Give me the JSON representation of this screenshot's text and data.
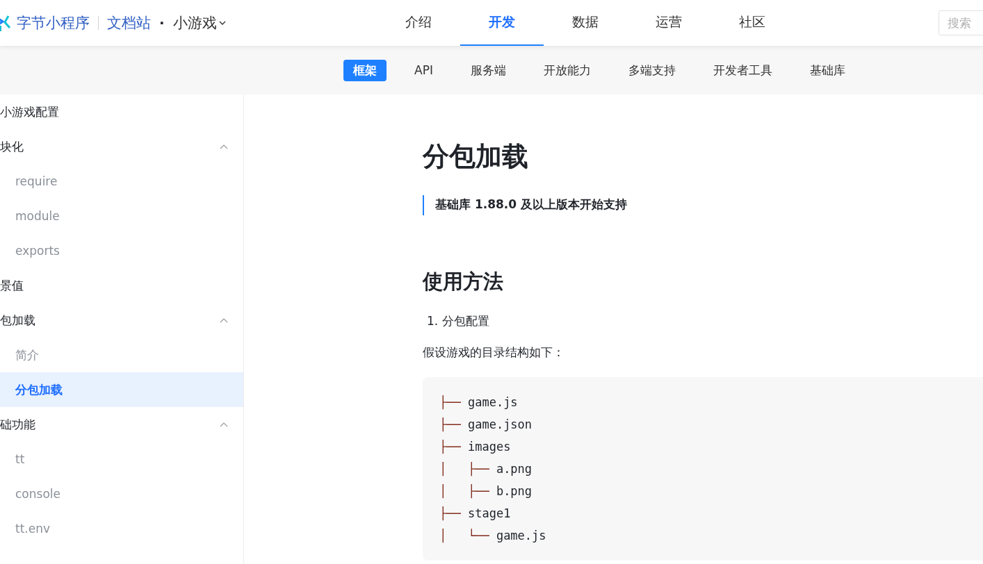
{
  "header": {
    "brand": "字节小程序",
    "site": "文档站",
    "separator": "·",
    "product": "小游戏",
    "nav": [
      {
        "label": "介绍",
        "selected": false
      },
      {
        "label": "开发",
        "selected": true
      },
      {
        "label": "数据",
        "selected": false
      },
      {
        "label": "运营",
        "selected": false
      },
      {
        "label": "社区",
        "selected": false
      }
    ],
    "search": {
      "placeholder": "搜索"
    }
  },
  "subnav": [
    {
      "label": "框架",
      "selected": true
    },
    {
      "label": "API",
      "selected": false
    },
    {
      "label": "服务端",
      "selected": false
    },
    {
      "label": "开放能力",
      "selected": false
    },
    {
      "label": "多端支持",
      "selected": false
    },
    {
      "label": "开发者工具",
      "selected": false
    },
    {
      "label": "基础库",
      "selected": false
    }
  ],
  "sidebar": {
    "items": [
      {
        "kind": "group",
        "label": "小游戏配置",
        "selected": false
      },
      {
        "kind": "group",
        "label": "块化",
        "expanded": true,
        "selected": false,
        "children": [
          {
            "label": "require",
            "selected": false
          },
          {
            "label": "module",
            "selected": false
          },
          {
            "label": "exports",
            "selected": false
          }
        ]
      },
      {
        "kind": "group",
        "label": "景值",
        "selected": false
      },
      {
        "kind": "group",
        "label": "包加载",
        "expanded": true,
        "selected": false,
        "children": [
          {
            "label": "简介",
            "selected": false
          },
          {
            "label": "分包加载",
            "selected": true
          }
        ]
      },
      {
        "kind": "group",
        "label": "础功能",
        "expanded": true,
        "selected": false,
        "children": [
          {
            "label": "tt",
            "selected": false
          },
          {
            "label": "console",
            "selected": false
          },
          {
            "label": "tt.env",
            "selected": false
          }
        ]
      }
    ]
  },
  "article": {
    "title": "分包加载",
    "note": "基础库 1.88.0 及以上版本开始支持",
    "section": "使用方法",
    "steps": [
      {
        "marker": "1.",
        "text": "分包配置"
      }
    ],
    "paragraph": "假设游戏的目录结构如下：",
    "code": [
      {
        "prefix": "├── ",
        "name": "game.js"
      },
      {
        "prefix": "├── ",
        "name": "game.json"
      },
      {
        "prefix": "├── ",
        "name": "images"
      },
      {
        "prefix": "│   ├── ",
        "name": "a.png"
      },
      {
        "prefix": "│   ├── ",
        "name": "b.png"
      },
      {
        "prefix": "├── ",
        "name": "stage1"
      },
      {
        "prefix": "│   └── ",
        "name": "game.js"
      }
    ]
  }
}
